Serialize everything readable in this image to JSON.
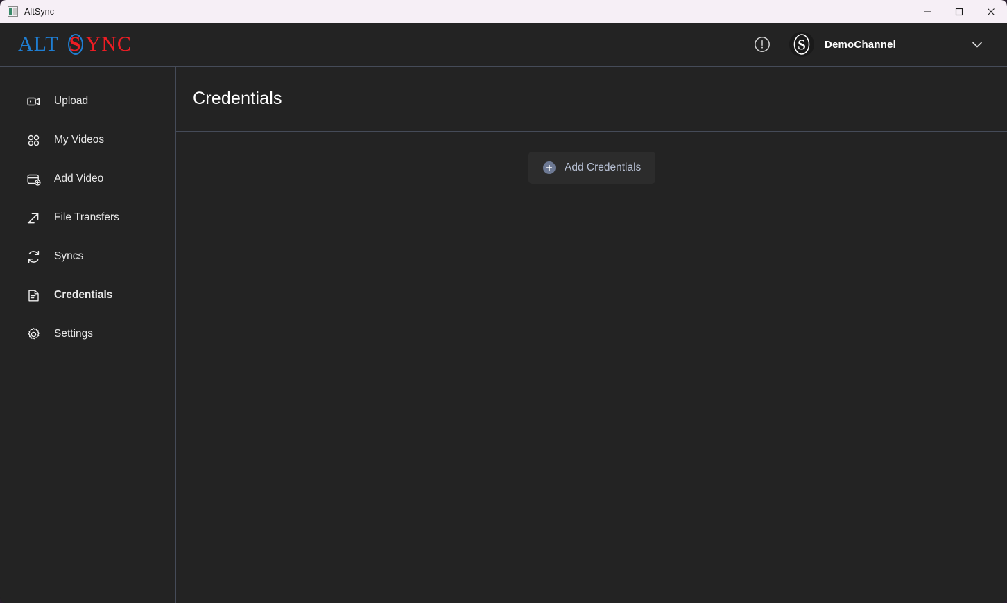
{
  "window": {
    "titlebar_title": "AltSync",
    "app_icon": "app-tile-icon",
    "controls": {
      "minimize": "minimize-icon",
      "maximize": "maximize-icon",
      "close": "close-icon"
    }
  },
  "header": {
    "logo": {
      "part1": "ALT",
      "part2": "S",
      "part3": "YNC",
      "color_part1": "#1f7fd4",
      "color_part2": "#ee1d24",
      "color_part3": "#ee1d24"
    },
    "alert_icon": "alert-circle-icon",
    "avatar_icon": "channel-avatar-s-icon",
    "channel_name": "DemoChannel",
    "chevron_icon": "chevron-down-icon"
  },
  "sidebar": {
    "items": [
      {
        "label": "Upload",
        "icon": "video-camera-icon",
        "active": false
      },
      {
        "label": "My Videos",
        "icon": "grid-circles-icon",
        "active": false
      },
      {
        "label": "Add Video",
        "icon": "window-plus-icon",
        "active": false
      },
      {
        "label": "File Transfers",
        "icon": "arrow-up-right-icon",
        "active": false
      },
      {
        "label": "Syncs",
        "icon": "refresh-icon",
        "active": false
      },
      {
        "label": "Credentials",
        "icon": "document-lines-icon",
        "active": true
      },
      {
        "label": "Settings",
        "icon": "gear-icon",
        "active": false
      }
    ]
  },
  "main": {
    "page_title": "Credentials",
    "add_button_label": "Add Credentials",
    "add_button_icon": "plus-circle-icon"
  },
  "colors": {
    "background": "#232323",
    "divider": "#454b58",
    "titlebar": "#f6eff6",
    "accent_blue": "#1f7fd4",
    "accent_red": "#ee1d24",
    "button_text": "#b7c0d4",
    "plus_circle": "#6d7994"
  }
}
